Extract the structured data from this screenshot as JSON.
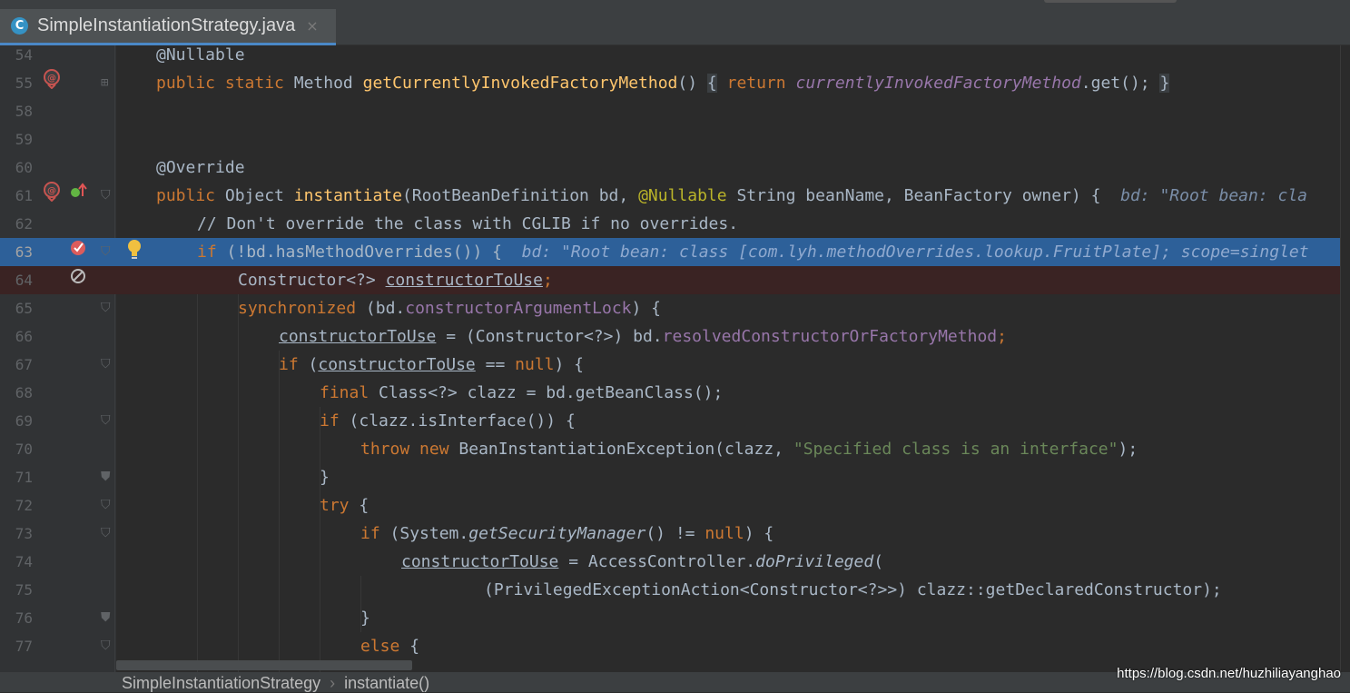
{
  "tab": {
    "icon": "C",
    "name": "SimpleInstantiationStrategy.java",
    "close": "×"
  },
  "lines": [
    {
      "num": "54"
    },
    {
      "num": "55"
    },
    {
      "num": "58"
    },
    {
      "num": "59"
    },
    {
      "num": "60"
    },
    {
      "num": "61"
    },
    {
      "num": "62"
    },
    {
      "num": "63"
    },
    {
      "num": "64"
    },
    {
      "num": "65"
    },
    {
      "num": "66"
    },
    {
      "num": "67"
    },
    {
      "num": "68"
    },
    {
      "num": "69"
    },
    {
      "num": "70"
    },
    {
      "num": "71"
    },
    {
      "num": "72"
    },
    {
      "num": "73"
    },
    {
      "num": "74"
    },
    {
      "num": "75"
    },
    {
      "num": "76"
    },
    {
      "num": "77"
    }
  ],
  "code": {
    "l54": "@Nullable",
    "l55": {
      "kw": "public static",
      "type": "Method",
      "fn": "getCurrentlyInvokedFactoryMethod",
      "paren": "()",
      "ob": "{",
      "ret": "return",
      "field": "currentlyInvokedFactoryMethod",
      "tail": ".get();",
      "cb": "}"
    },
    "l60": "@Override",
    "l61": {
      "kw": "public",
      "a": "Object",
      "fn": "instantiate",
      "b": "(RootBeanDefinition bd,",
      "ann": "@Nullable",
      "c": "String beanName, BeanFactory owner) {",
      "hint": "bd: \"Root bean: cla"
    },
    "l62": "// Don't override the class with CGLIB if no overrides.",
    "l63": {
      "kw": "if",
      "a": "(!bd.hasMethodOverrides()) {",
      "hint": "bd: \"Root bean: class [com.lyh.methodOverrides.lookup.FruitPlate]; scope=singlet"
    },
    "l64": {
      "a": "Constructor<?>",
      "u": "constructorToUse",
      "s": ";"
    },
    "l65": {
      "kw": "synchronized",
      "a": "(bd.",
      "f": "constructorArgumentLock",
      "b": ") {"
    },
    "l66": {
      "u": "constructorToUse",
      "a": "= (Constructor<?>) bd.",
      "f": "resolvedConstructorOrFactoryMethod",
      "s": ";"
    },
    "l67": {
      "kw": "if",
      "a": "(",
      "u": "constructorToUse",
      "b": "==",
      "n": "null",
      "c": ") {"
    },
    "l68": {
      "kw": "final",
      "a": "Class<?> clazz = bd.getBeanClass();"
    },
    "l69": {
      "kw": "if",
      "a": "(clazz.isInterface()) {"
    },
    "l70": {
      "kw": "throw new",
      "a": "BeanInstantiationException(clazz,",
      "str": "\"Specified class is an interface\"",
      "b": ");"
    },
    "l71": "}",
    "l72": {
      "kw": "try",
      "a": "{"
    },
    "l73": {
      "kw": "if",
      "a": "(System.",
      "i": "getSecurityManager",
      "b": "() !=",
      "n": "null",
      "c": ") {"
    },
    "l74": {
      "u": "constructorToUse",
      "a": "= AccessController.",
      "i": "doPrivileged",
      "b": "("
    },
    "l75": "(PrivilegedExceptionAction<Constructor<?>>) clazz::getDeclaredConstructor);",
    "l76": "}",
    "l77": {
      "kw": "else",
      "a": "{"
    }
  },
  "breadcrumb": {
    "cls": "SimpleInstantiationStrategy",
    "sep": "›",
    "method": "instantiate()"
  },
  "watermark": "https://blog.csdn.net/huzhiliayanghao",
  "colors": {
    "keyword": "#cc7832",
    "annotation": "#bbb529",
    "method": "#ffc66d",
    "field": "#9876aa",
    "string": "#6a8759",
    "exec_line": "#2d6099",
    "breakpoint_line": "#3a2323"
  }
}
